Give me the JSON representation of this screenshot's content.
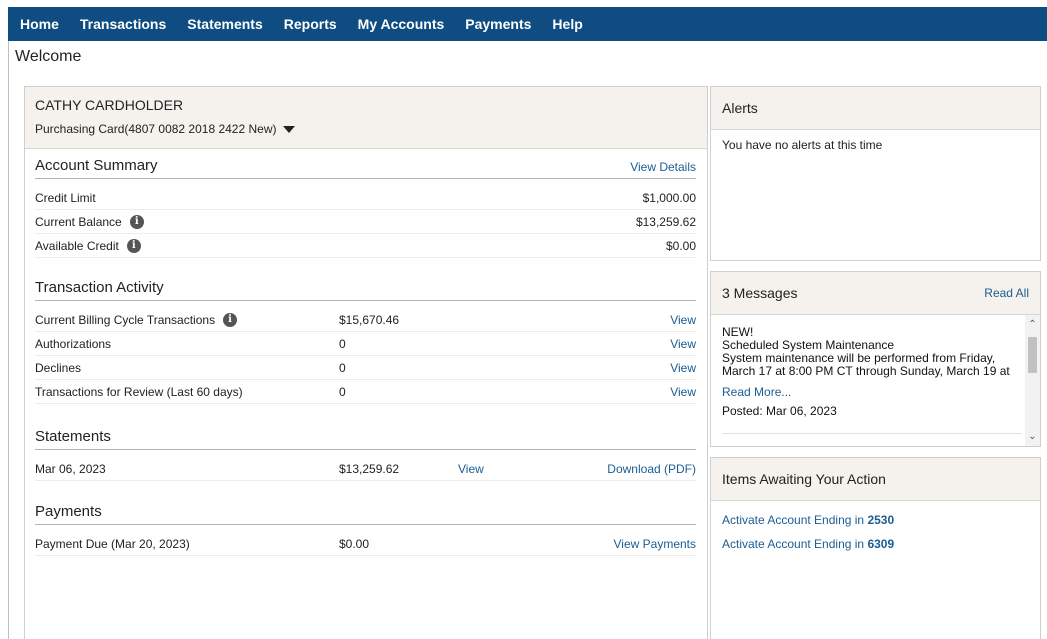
{
  "nav": {
    "items": [
      "Home",
      "Transactions",
      "Statements",
      "Reports",
      "My Accounts",
      "Payments",
      "Help"
    ]
  },
  "page": {
    "title": "Welcome"
  },
  "account": {
    "holder": "CATHY CARDHOLDER",
    "card": "Purchasing Card(4807 0082 2018 2422 New)"
  },
  "summary": {
    "title": "Account Summary",
    "view_details": "View Details",
    "rows": [
      {
        "label": "Credit Limit",
        "value": "$1,000.00"
      },
      {
        "label": "Current Balance",
        "value": "$13,259.62"
      },
      {
        "label": "Available Credit",
        "value": "$0.00"
      }
    ]
  },
  "activity": {
    "title": "Transaction Activity",
    "rows": [
      {
        "label": "Current Billing Cycle Transactions",
        "value": "$15,670.46",
        "link": "View"
      },
      {
        "label": "Authorizations",
        "value": "0",
        "link": "View"
      },
      {
        "label": "Declines",
        "value": "0",
        "link": "View"
      },
      {
        "label": "Transactions for Review (Last 60 days)",
        "value": "0",
        "link": "View"
      }
    ]
  },
  "statements": {
    "title": "Statements",
    "rows": [
      {
        "date": "Mar 06, 2023",
        "amount": "$13,259.62",
        "view": "View",
        "download": "Download (PDF)"
      }
    ]
  },
  "payments": {
    "title": "Payments",
    "rows": [
      {
        "label": "Payment Due (Mar 20, 2023)",
        "value": "$0.00",
        "link": "View Payments"
      }
    ]
  },
  "alerts": {
    "title": "Alerts",
    "empty": "You have no alerts at this time"
  },
  "messages": {
    "title": "3 Messages",
    "read_all": "Read All",
    "items": [
      {
        "tag": "NEW!",
        "subject": "Scheduled System Maintenance",
        "line1": "System maintenance will be performed from Friday,",
        "line2": "March 17 at 8:00 PM CT through Sunday, March 19 at",
        "read_more": "Read More...",
        "posted": "Posted:  Mar 06, 2023"
      }
    ]
  },
  "actions": {
    "title": "Items Awaiting Your Action",
    "items": [
      {
        "text": "Activate Account Ending in ",
        "ending": "2530"
      },
      {
        "text": "Activate Account Ending in ",
        "ending": "6309"
      }
    ]
  },
  "icons": {
    "info": "info-circle-icon",
    "caret": "caret-down-icon",
    "scroll_up": "chevron-up-icon",
    "scroll_down": "chevron-down-icon"
  },
  "colors": {
    "nav_bg": "#0f4c81",
    "link": "#1b5d94",
    "panel_header_bg": "#f5f1ed"
  }
}
